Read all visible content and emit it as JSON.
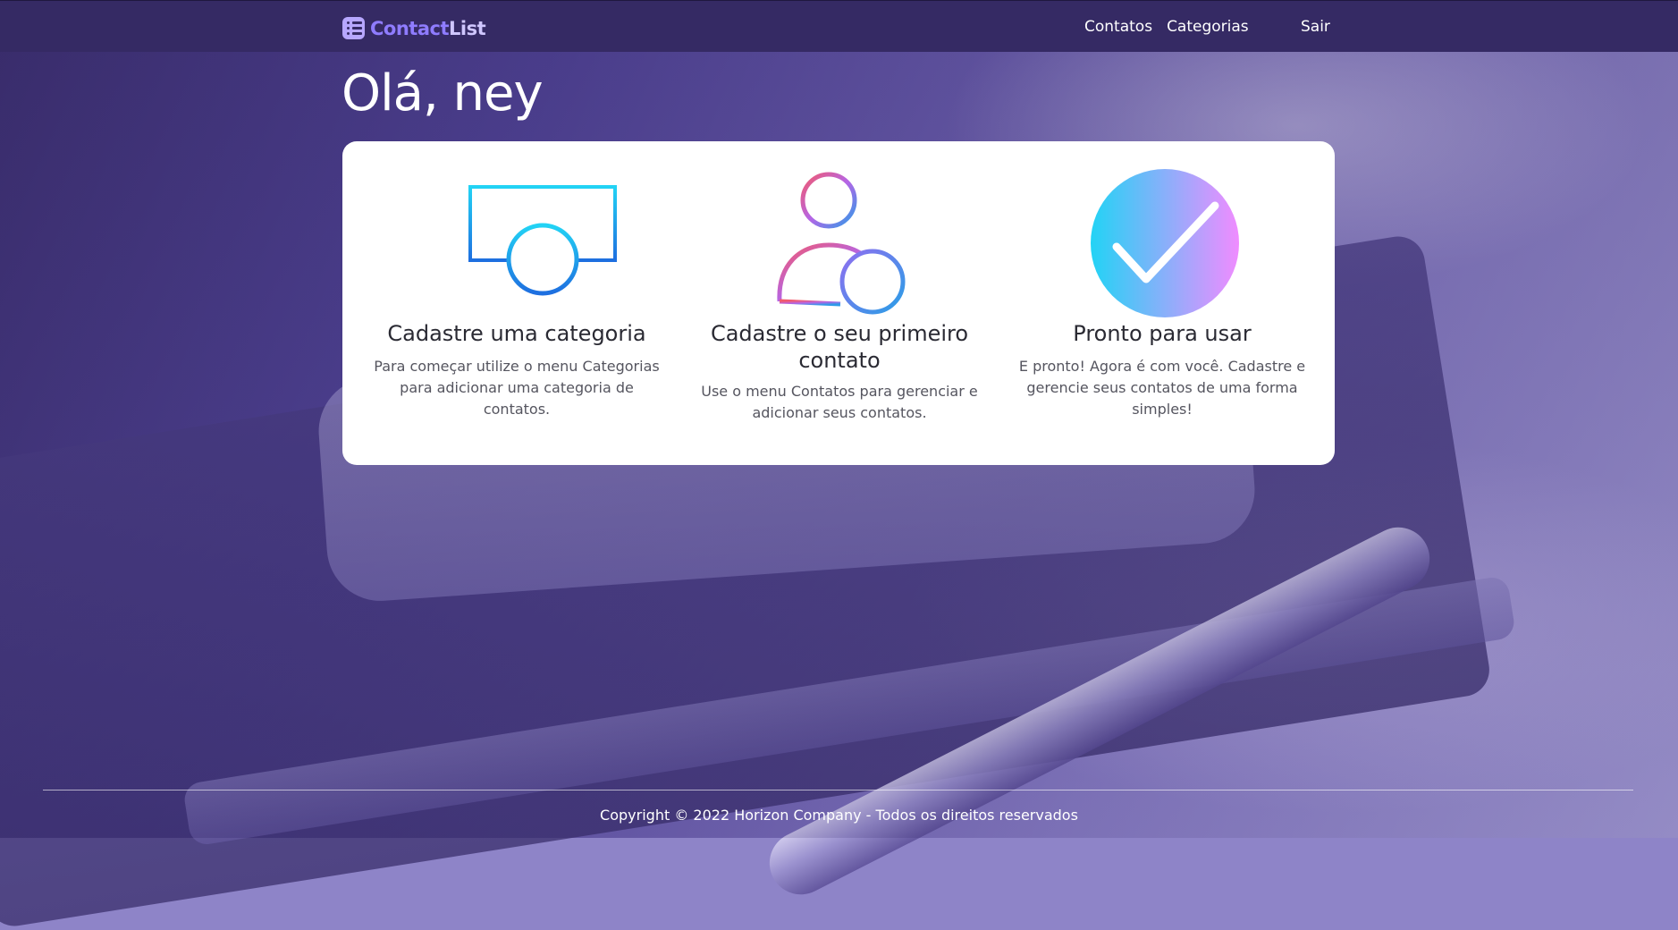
{
  "brand": {
    "part1": "Contact",
    "part2": "List",
    "icon": "list-icon"
  },
  "nav": {
    "contacts": "Contatos",
    "categories": "Categorias",
    "logout": "Sair"
  },
  "greeting": "Olá, ney",
  "steps": [
    {
      "icon": "add-category-icon",
      "title": "Cadastre uma categoria",
      "text": "Para começar utilize o menu Categorias para adicionar uma categoria de contatos."
    },
    {
      "icon": "add-user-icon",
      "title": "Cadastre o seu primeiro contato",
      "text": "Use o menu Contatos para gerenciar e adicionar seus contatos."
    },
    {
      "icon": "checkmark-circle-icon",
      "title": "Pronto para usar",
      "text": "E pronto! Agora é com você. Cadastre e gerencie seus contatos de uma forma simples!"
    }
  ],
  "footer": "Copyright © 2022 Horizon Company - Todos os direitos reservados",
  "colors": {
    "navbar": "#352a64",
    "brand_primary": "#8f7cff",
    "brand_secondary": "#cfc6ff",
    "gradient_cyan": "#22d3f5",
    "gradient_pink": "#f08cff",
    "gradient_blue": "#1e6fe0"
  }
}
